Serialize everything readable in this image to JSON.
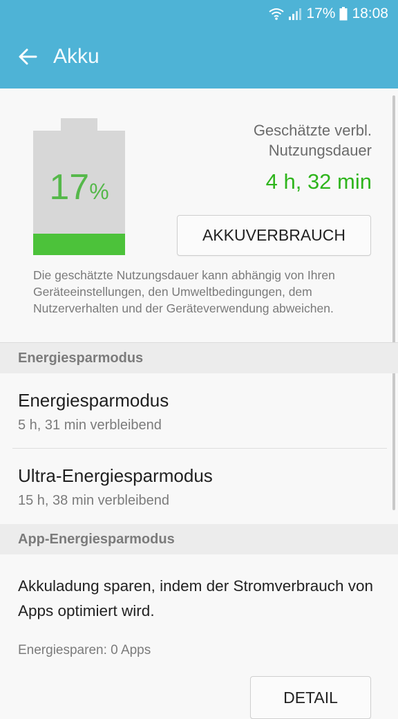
{
  "status_bar": {
    "battery_percent": "17%",
    "time": "18:08",
    "icons": [
      "wifi-icon",
      "signal-icon",
      "battery-icon"
    ]
  },
  "app_bar": {
    "back_icon": "arrow-left-icon",
    "title": "Akku"
  },
  "battery": {
    "level": 0.17,
    "percent_number": "17",
    "percent_symbol": "%",
    "colors": {
      "fill": "#4cc23a",
      "text": "#55b84a",
      "empty": "#d7d7d7"
    }
  },
  "estimate": {
    "label": "Geschätzte verbl. Nutzungsdauer",
    "value": "4 h, 32 min",
    "value_color": "#2fb51d"
  },
  "usage_button": {
    "label": "AKKUVERBRAUCH"
  },
  "disclaimer": "Die geschätzte Nutzungsdauer kann abhängig von Ihren Geräteeinstellungen, den Umweltbedingungen, dem Nutzerverhalten und der Geräteverwendung abweichen.",
  "power_saving": {
    "header": "Energiesparmodus",
    "items": [
      {
        "title": "Energiesparmodus",
        "subtitle": "5 h, 31 min verbleibend"
      },
      {
        "title": "Ultra-Energiesparmodus",
        "subtitle": "15 h, 38 min verbleibend"
      }
    ]
  },
  "app_power_saving": {
    "header": "App-Energiesparmodus",
    "description": "Akkuladung sparen, indem der Stromverbrauch von Apps optimiert wird.",
    "saving_count": "Energiesparen: 0 Apps",
    "detail_button": "DETAIL"
  },
  "colors": {
    "accent": "#4eb3d6"
  }
}
